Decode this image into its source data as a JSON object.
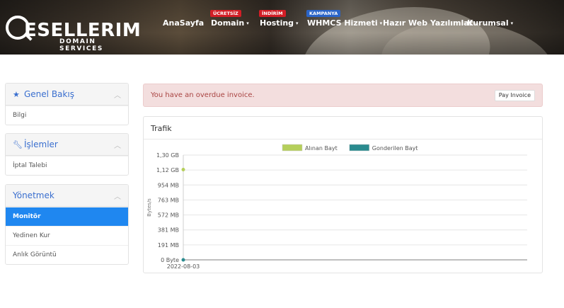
{
  "brand": {
    "logo_text": "ESELLERIM",
    "tagline": "DOMAIN SERVICES"
  },
  "nav": {
    "items": [
      {
        "label": "AnaSayfa",
        "caret": ""
      },
      {
        "label": "Domain",
        "caret": "▾"
      },
      {
        "label": "Hosting",
        "caret": "▾"
      },
      {
        "label": "WHMCS Hizmeti",
        "caret": "▾"
      },
      {
        "label": "Hazır Web Yazılımlar",
        "caret": ""
      },
      {
        "label": "Kurumsal",
        "caret": "▾"
      }
    ],
    "badges": [
      {
        "label": "ÜCRETSİZ",
        "color": "#d21e26"
      },
      {
        "label": "İNDİRİM",
        "color": "#d21e26"
      },
      {
        "label": "KAMPANYA",
        "color": "#2a64c8"
      }
    ]
  },
  "sidebar": {
    "panels": [
      {
        "title": "Genel Bakış",
        "icon": "star-icon",
        "items": [
          {
            "label": "Bilgi",
            "active": false
          }
        ]
      },
      {
        "title": "İşlemler",
        "icon": "wrench-icon",
        "items": [
          {
            "label": "İptal Talebi",
            "active": false
          }
        ]
      },
      {
        "title": "Yönetmek",
        "icon": "",
        "items": [
          {
            "label": "Monitör",
            "active": true
          },
          {
            "label": "Yedinen Kur",
            "active": false
          },
          {
            "label": "Anlık Görüntü",
            "active": false
          }
        ]
      }
    ]
  },
  "alert": {
    "text": "You have an overdue invoice.",
    "button": "Pay Invoice"
  },
  "traffic": {
    "title": "Trafik"
  },
  "colors": {
    "accent": "#1f87f0",
    "received": "#b5cf5b",
    "sent": "#2a8b8f",
    "alert_text": "#a94442"
  },
  "chart_data": {
    "type": "line",
    "ylabel": "Bytes/s",
    "yticks": [
      "1,30 GB",
      "1,12 GB",
      "954 MB",
      "763 MB",
      "572 MB",
      "381 MB",
      "191 MB",
      "0 Byte"
    ],
    "categories": [
      "2022-08-03"
    ],
    "ylim": [
      0,
      1.3
    ],
    "legend": "top",
    "grid": true,
    "series": [
      {
        "name": "Alınan Bayt",
        "color": "#b5cf5b",
        "values": [
          1.12
        ]
      },
      {
        "name": "Gonderilen Bayt",
        "color": "#2a8b8f",
        "values": [
          0
        ]
      }
    ]
  }
}
